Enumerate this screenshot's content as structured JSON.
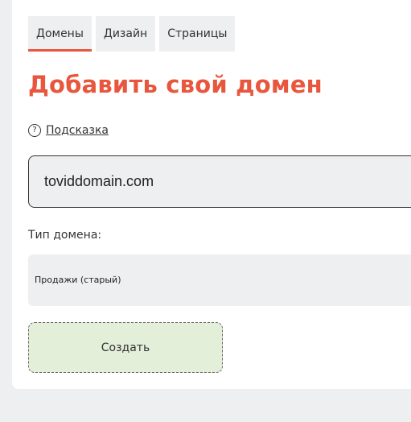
{
  "tabs": [
    {
      "label": "Домены",
      "active": true
    },
    {
      "label": "Дизайн",
      "active": false
    },
    {
      "label": "Страницы",
      "active": false
    }
  ],
  "main": {
    "title": "Добавить свой домен",
    "hint": {
      "icon": "question-circle-icon",
      "icon_glyph": "?",
      "label": "Подсказка"
    },
    "domain_input": {
      "value": "toviddomain.com"
    },
    "domain_type": {
      "label": "Тип домена:",
      "selected": "Продажи (старый)"
    },
    "create_button": {
      "label": "Создать"
    }
  },
  "colors": {
    "accent": "#e8573d",
    "background": "#eeeff1",
    "panel": "#ffffff",
    "button": "#e4efda"
  }
}
